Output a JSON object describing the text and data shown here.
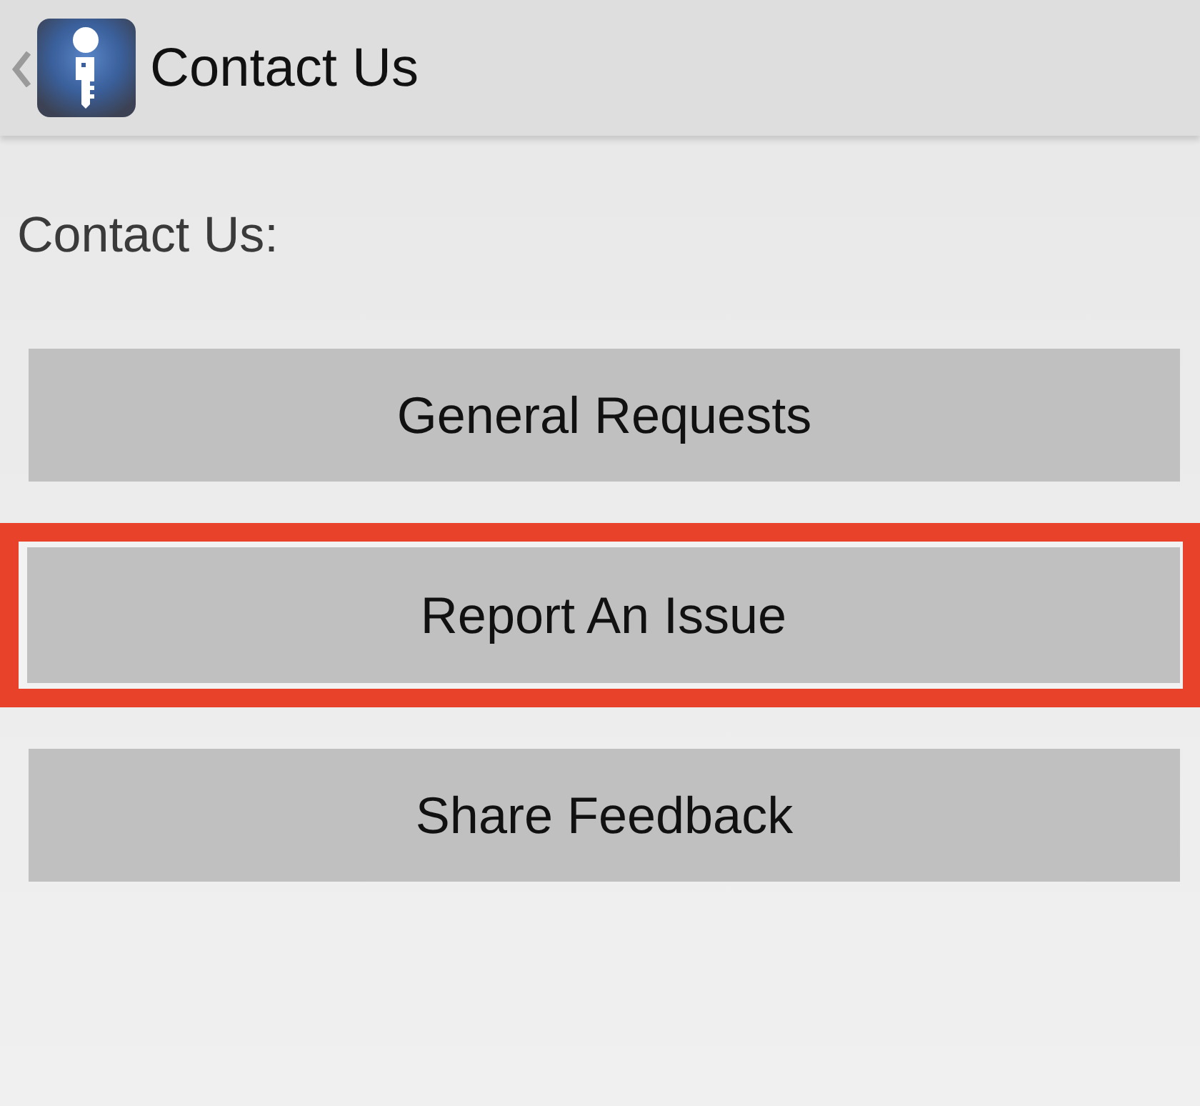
{
  "header": {
    "title": "Contact Us"
  },
  "content": {
    "heading": "Contact Us:",
    "buttons": [
      {
        "label": "General Requests",
        "highlighted": false
      },
      {
        "label": "Report An Issue",
        "highlighted": true
      },
      {
        "label": "Share Feedback",
        "highlighted": false
      }
    ]
  }
}
